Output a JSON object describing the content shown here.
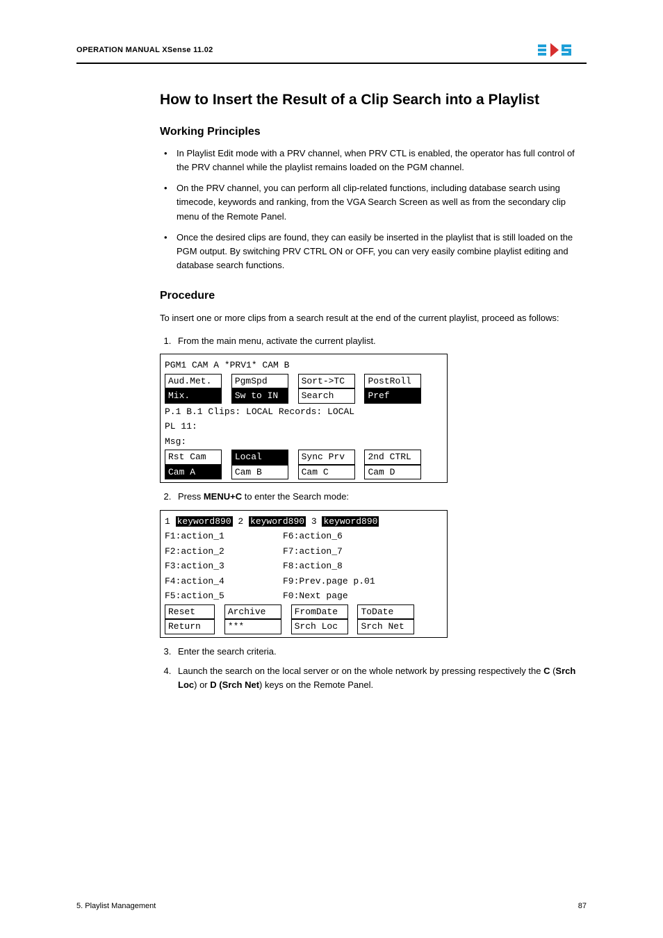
{
  "header": {
    "manual_title": "OPERATION MANUAL XSense 11.02",
    "logo_alt": "EVS"
  },
  "section": {
    "title": "How to Insert the Result of a Clip Search into a Playlist"
  },
  "working_principles": {
    "heading": "Working Principles",
    "bullets": [
      "In Playlist Edit mode with a PRV channel, when PRV CTL is enabled, the operator has full control of the PRV channel while the playlist remains loaded on the PGM channel.",
      "On the PRV channel, you can perform all clip-related functions, including database search using timecode, keywords and ranking, from the VGA Search Screen as well as from the secondary clip menu of the Remote Panel.",
      "Once the desired clips are found, they can easily be inserted in the playlist that is still loaded on the PGM output. By switching PRV CTRL ON or OFF, you can very easily combine playlist editing and database search functions."
    ]
  },
  "procedure": {
    "heading": "Procedure",
    "intro": "To insert one or more clips from a search result at the end of the current playlist, proceed as follows:",
    "step1": "From the main menu, activate the current playlist.",
    "step2_pre": "Press ",
    "step2_bold": "MENU+C",
    "step2_post": "  to enter the Search mode:",
    "step3": "Enter the search criteria.",
    "step4_pre": "Launch the search on the local server or on the whole network by pressing respectively the ",
    "step4_b1": "C",
    "step4_mid1": " (",
    "step4_b2": "Srch Loc",
    "step4_mid2": ") or ",
    "step4_b3": "D (Srch Net",
    "step4_post": ") keys on the Remote Panel."
  },
  "codebox1": {
    "line1": "PGM1 CAM A    *PRV1* CAM B",
    "r1": {
      "a": "Aud.Met.",
      "b": "PgmSpd",
      "c": "Sort->TC",
      "d": "PostRoll"
    },
    "r2": {
      "a": "Mix.",
      "b": "Sw to IN",
      "c": "Search",
      "d": "Pref"
    },
    "line3": "P.1 B.1 Clips: LOCAL Records: LOCAL",
    "line4": "PL 11:",
    "line5": "Msg:",
    "r3": {
      "a": "Rst Cam",
      "b": "Local",
      "c": "Sync Prv",
      "d": "2nd CTRL"
    },
    "r4": {
      "a": "Cam A",
      "b": "Cam B",
      "c": "Cam C",
      "d": "Cam D"
    }
  },
  "codebox2": {
    "top_1": "1 ",
    "top_kw1": "keyword890",
    "top_2": " 2 ",
    "top_kw2": "keyword890",
    "top_3": " 3 ",
    "top_kw3": "keyword890",
    "f1": "F1:action_1",
    "f6": "F6:action_6",
    "f2": "F2:action_2",
    "f7": "F7:action_7",
    "f3": "F3:action_3",
    "f8": "F8:action_8",
    "f4": "F4:action_4",
    "f9": "F9:Prev.page   p.01",
    "f5": "F5:action_5",
    "f0": "F0:Next page",
    "r1": {
      "a": "Reset",
      "b": "Archive",
      "c": "FromDate",
      "d": "ToDate"
    },
    "r2": {
      "a": "Return",
      "b": "***",
      "c": "Srch Loc",
      "d": "Srch Net"
    }
  },
  "footer": {
    "left": "5. Playlist Management",
    "right": "87"
  }
}
